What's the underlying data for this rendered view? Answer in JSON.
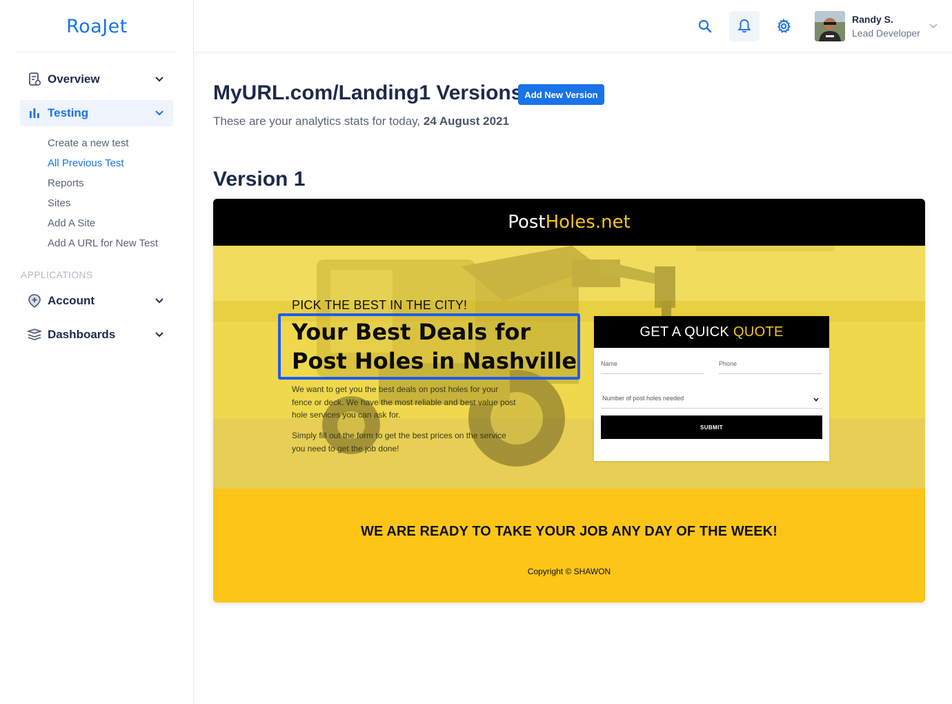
{
  "brand": {
    "logo_text": "RoaJet",
    "accent": "#1a73e8"
  },
  "sidebar": {
    "items": [
      {
        "label": "Overview",
        "icon": "page-edit-icon"
      },
      {
        "label": "Testing",
        "icon": "bar-chart-icon",
        "active": true
      },
      {
        "label": "Account",
        "icon": "location-plus-icon"
      },
      {
        "label": "Dashboards",
        "icon": "layers-icon"
      }
    ],
    "testing_sub": [
      "Create a new test",
      "All Previous Test",
      "Reports",
      "Sites",
      "Add A Site",
      "Add A URL for New Test"
    ],
    "section_applications": "APPLICATIONS"
  },
  "header": {
    "user_name": "Randy S.",
    "user_role": "Lead Developer"
  },
  "main": {
    "title": "MyURL.com/Landing1 Versions",
    "add_button": "Add New Version",
    "subtitle_prefix": "These are your analytics stats for today,",
    "subtitle_date": "24 August 2021",
    "version_title": "Version 1"
  },
  "preview": {
    "brand_white": "Post",
    "brand_yellow": "Holes.net",
    "eyebrow": "PICK THE BEST IN THE CITY!",
    "headline": "Your Best Deals for Post Holes in Nashville",
    "paragraph1": "We want to get you the best deals on post holes for your fence or deck.  We have the most reliable and best value post hole services you can ask for.",
    "paragraph2": "Simply fill out the form to get the best prices on the service you need to get the job done!",
    "quote_title_white": "GET A QUICK",
    "quote_title_yellow": "QUOTE",
    "name_placeholder": "Name",
    "phone_placeholder": "Phone",
    "select_placeholder": "Number of post holes needed",
    "submit_label": "SUBMIT",
    "cta": "WE ARE READY TO TAKE YOUR JOB ANY DAY OF THE WEEK!",
    "copyright": "Copyright © SHAWON",
    "colors": {
      "yellow": "#fdc518",
      "highlight": "#1a5cf5"
    }
  }
}
